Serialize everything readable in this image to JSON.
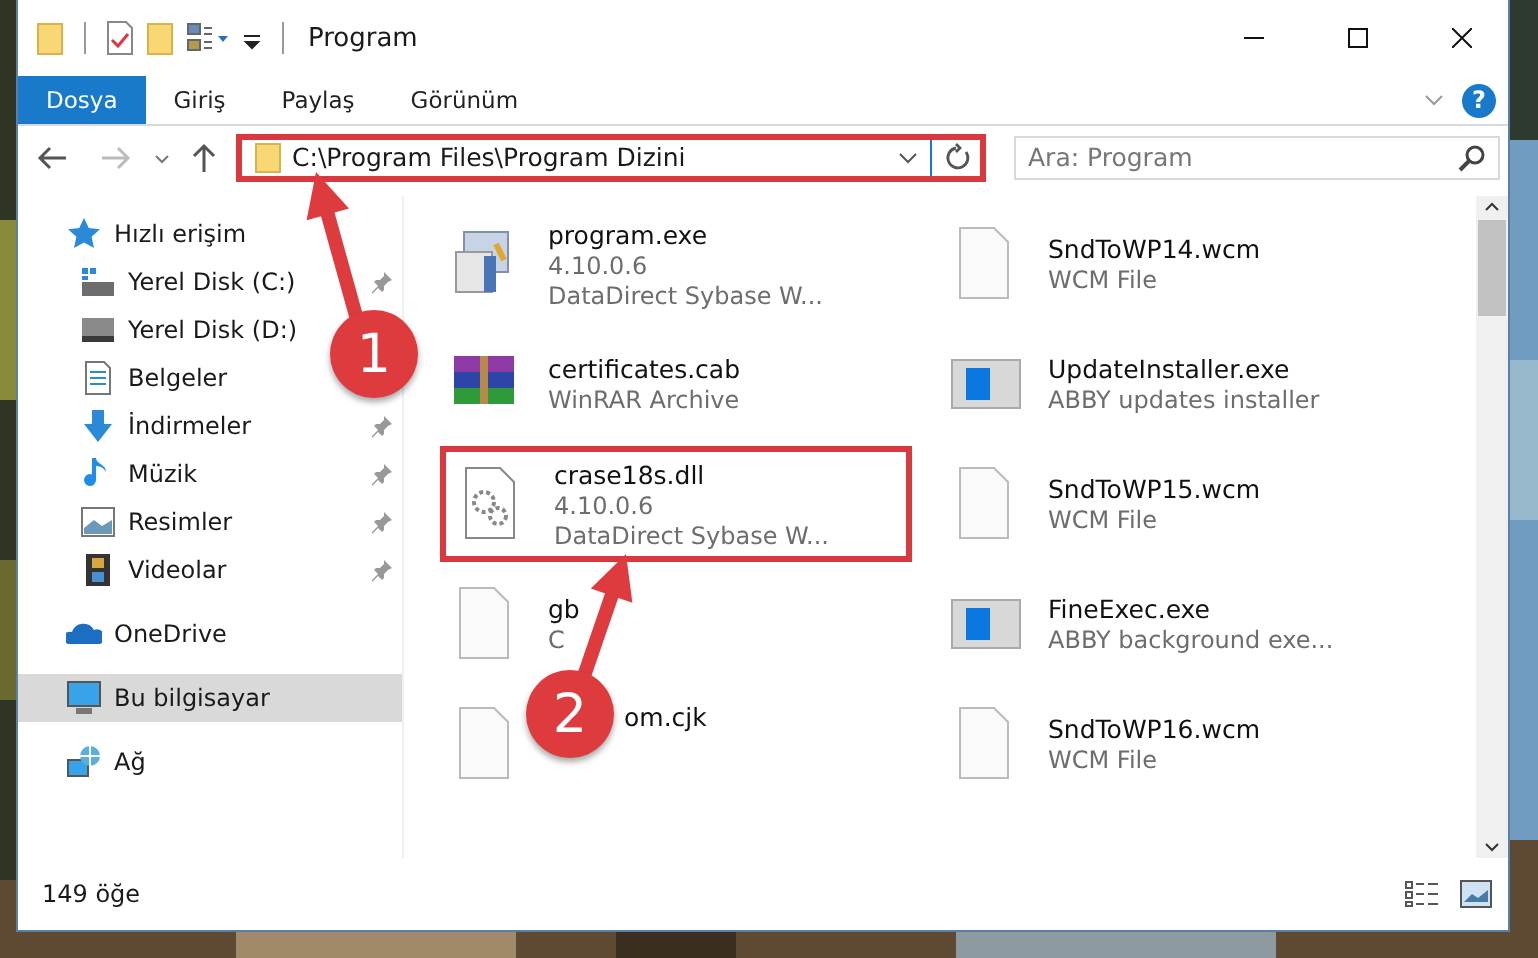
{
  "window": {
    "title": "Program"
  },
  "ribbon": {
    "tabs": [
      {
        "label": "Dosya",
        "selected": true
      },
      {
        "label": "Giriş",
        "selected": false
      },
      {
        "label": "Paylaş",
        "selected": false
      },
      {
        "label": "Görünüm",
        "selected": false
      }
    ],
    "help": "?"
  },
  "address_bar": {
    "path": "C:\\Program Files\\Program Dizini",
    "highlighted": true
  },
  "search": {
    "placeholder": "Ara: Program"
  },
  "navigation": [
    {
      "label": "Hızlı erişim",
      "kind": "quick-access",
      "selected": false,
      "children": [
        {
          "label": "Yerel Disk (C:)",
          "kind": "drive-c",
          "pinned": true,
          "selected": false
        },
        {
          "label": "Yerel Disk (D:)",
          "kind": "drive",
          "pinned": false,
          "selected": false
        },
        {
          "label": "Belgeler",
          "kind": "documents",
          "pinned": false,
          "selected": false
        },
        {
          "label": "İndirmeler",
          "kind": "downloads",
          "pinned": true,
          "selected": false
        },
        {
          "label": "Müzik",
          "kind": "music",
          "pinned": true,
          "selected": false
        },
        {
          "label": "Resimler",
          "kind": "pictures",
          "pinned": true,
          "selected": false
        },
        {
          "label": "Videolar",
          "kind": "videos",
          "pinned": true,
          "selected": false
        }
      ]
    },
    {
      "label": "OneDrive",
      "kind": "onedrive",
      "selected": false
    },
    {
      "label": "Bu bilgisayar",
      "kind": "computer",
      "selected": true
    },
    {
      "label": "Ağ",
      "kind": "network",
      "selected": false
    }
  ],
  "files": [
    {
      "name": "program.exe",
      "details": [
        "4.10.0.6",
        "DataDirect Sybase W..."
      ],
      "kind": "exe",
      "highlighted": false
    },
    {
      "name": "SndToWP14.wcm",
      "details": [
        "WCM File"
      ],
      "kind": "blank",
      "highlighted": false
    },
    {
      "name": "certificates.cab",
      "details": [
        "WinRAR Archive"
      ],
      "kind": "archive",
      "highlighted": false
    },
    {
      "name": "UpdateInstaller.exe",
      "details": [
        "ABBY updates installer"
      ],
      "kind": "app",
      "highlighted": false
    },
    {
      "name": "crase18s.dll",
      "details": [
        "4.10.0.6",
        "DataDirect Sybase W..."
      ],
      "kind": "dll",
      "highlighted": true
    },
    {
      "name": "SndToWP15.wcm",
      "details": [
        "WCM File"
      ],
      "kind": "blank",
      "highlighted": false
    },
    {
      "name": "gb",
      "details": [
        "C"
      ],
      "kind": "blank",
      "highlighted": false
    },
    {
      "name": "FineExec.exe",
      "details": [
        "ABBY background exe..."
      ],
      "kind": "app",
      "highlighted": false
    },
    {
      "name": "om.cjk",
      "kind": "blank",
      "highlighted": false,
      "text_start_covered": true
    },
    {
      "name": "SndToWP16.wcm",
      "details": [
        "WCM File"
      ],
      "kind": "blank",
      "highlighted": false
    }
  ],
  "status_bar": {
    "item_count": "149 öğe"
  },
  "annotations": [
    {
      "number": "1"
    },
    {
      "number": "2"
    }
  ]
}
